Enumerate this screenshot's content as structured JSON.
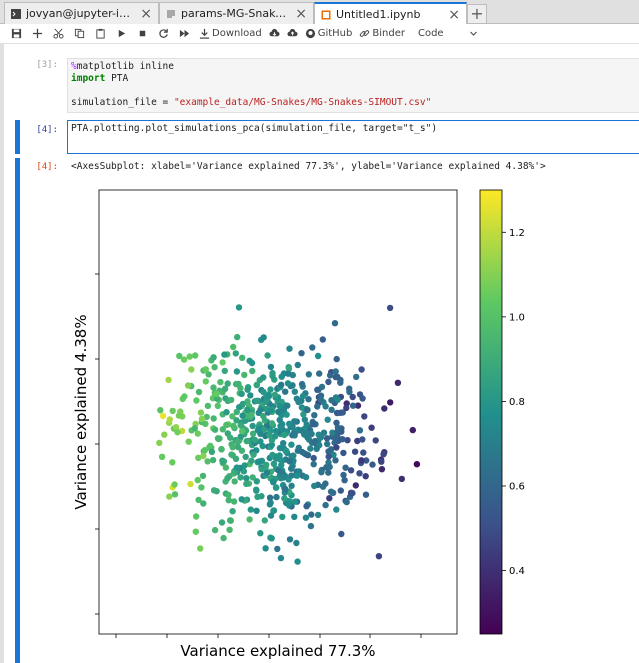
{
  "tabs": [
    {
      "label": "jovyan@jupyter-isaacoverca",
      "icon": "terminal-icon"
    },
    {
      "label": "params-MG-Snakes.txt",
      "icon": "text-file-icon"
    },
    {
      "label": "Untitled1.ipynb",
      "icon": "notebook-icon"
    }
  ],
  "toolbar": {
    "download_label": "Download",
    "github_label": "GitHub",
    "binder_label": "Binder",
    "cell_type": "Code"
  },
  "cells": [
    {
      "prompt": "[3]:",
      "lines": [
        "%matplotlib inline",
        "import PTA",
        "",
        "simulation_file = \"example_data/MG-Snakes/MG-Snakes-SIMOUT.csv\""
      ]
    },
    {
      "prompt": "[4]:",
      "code": "PTA.plotting.plot_simulations_pca(simulation_file, target=\"t_s\")"
    }
  ],
  "output": {
    "prompt": "[4]:",
    "text": "<AxesSubplot: xlabel='Variance explained 77.3%', ylabel='Variance explained 4.38%'>"
  },
  "chart_data": {
    "type": "scatter",
    "xlabel": "Variance explained 77.3%",
    "ylabel": "Variance explained 4.38%",
    "colorbar": {
      "ticks": [
        "0.4",
        "0.6",
        "0.8",
        "1.0",
        "1.2"
      ],
      "range": [
        0.25,
        1.3
      ],
      "colormap": "viridis"
    },
    "colors": {
      "low": "#440154",
      "mid": "#21918c",
      "high": "#fde725"
    }
  }
}
